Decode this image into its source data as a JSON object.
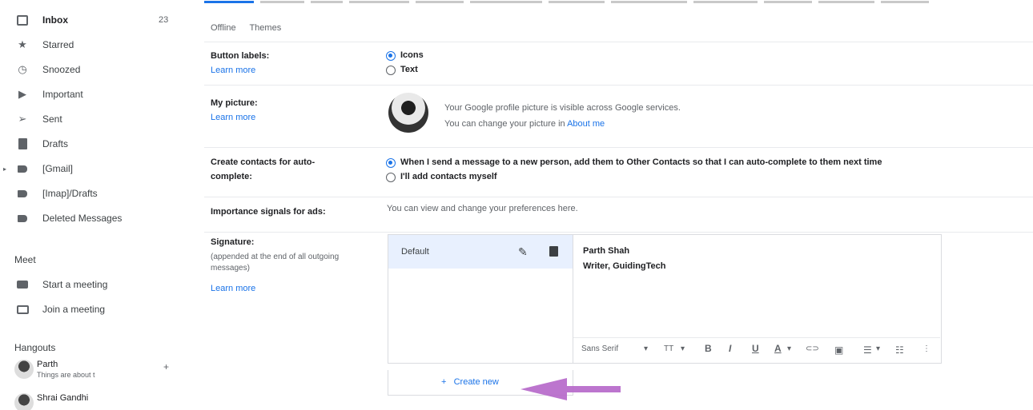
{
  "sidebar": {
    "items": [
      {
        "label": "Inbox",
        "count": "23",
        "icon": "inbox-icon"
      },
      {
        "label": "Starred",
        "icon": "star-icon"
      },
      {
        "label": "Snoozed",
        "icon": "clock-icon"
      },
      {
        "label": "Important",
        "icon": "important-icon"
      },
      {
        "label": "Sent",
        "icon": "send-icon"
      },
      {
        "label": "Drafts",
        "icon": "draft-icon"
      },
      {
        "label": "[Gmail]",
        "icon": "label-icon"
      },
      {
        "label": "[Imap]/Drafts",
        "icon": "label-icon"
      },
      {
        "label": "Deleted Messages",
        "icon": "label-icon"
      }
    ],
    "meet": {
      "title": "Meet",
      "items": [
        {
          "label": "Start a meeting",
          "icon": "video-icon"
        },
        {
          "label": "Join a meeting",
          "icon": "keyboard-icon"
        }
      ]
    },
    "hangouts": {
      "title": "Hangouts",
      "contacts": [
        {
          "name": "Parth",
          "status": "Things are about t"
        },
        {
          "name": "Shrai Gandhi",
          "status": ""
        }
      ]
    }
  },
  "settings": {
    "subtabs": [
      "Offline",
      "Themes"
    ],
    "button_labels": {
      "label": "Button labels:",
      "learn": "Learn more",
      "options": [
        "Icons",
        "Text"
      ],
      "selected": "Icons"
    },
    "my_picture": {
      "label": "My picture:",
      "learn": "Learn more",
      "line1": "Your Google profile picture is visible across Google services.",
      "line2_prefix": "You can change your picture in ",
      "line2_link": "About me"
    },
    "contacts": {
      "label_line1": "Create contacts for auto-",
      "label_line2": "complete:",
      "options": [
        "When I send a message to a new person, add them to Other Contacts so that I can auto-complete to them next time",
        "I'll add contacts myself"
      ],
      "selected": 0
    },
    "importance": {
      "label": "Importance signals for ads:",
      "text": "You can view and change your preferences here."
    },
    "signature": {
      "label": "Signature:",
      "note": "(appended at the end of all outgoing messages)",
      "learn": "Learn more",
      "list": [
        {
          "name": "Default"
        }
      ],
      "content_line1": "Parth Shah",
      "content_line2": "Writer, GuidingTech",
      "toolbar": {
        "font": "Sans Serif",
        "size": "TT",
        "bold": "B",
        "italic": "I",
        "underline": "U",
        "text_color": "A",
        "link": "⊂⊃"
      },
      "create_new": "Create new"
    }
  },
  "colors": {
    "accent": "#1a73e8",
    "arrow": "#b566c9"
  }
}
